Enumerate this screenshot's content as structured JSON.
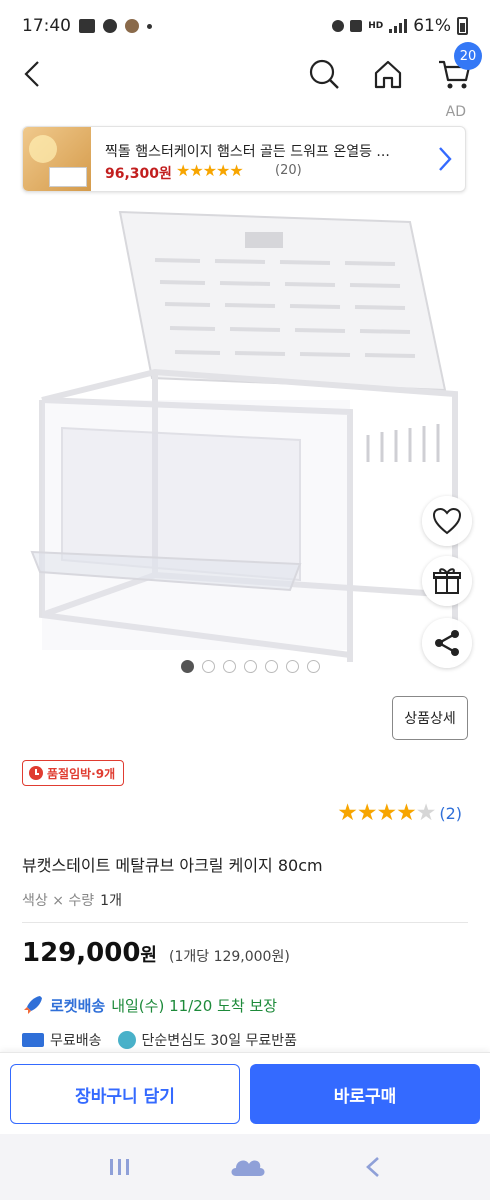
{
  "status_bar": {
    "time": "17:40",
    "battery": "61%",
    "network": "HD"
  },
  "nav": {
    "cart_count": "20"
  },
  "ad": {
    "tag": "AD",
    "title": "찍돌 햄스터케이지 햄스터 골든 드워프 온열등 ...",
    "price": "96,300원",
    "stars": "★★★★★",
    "review_count": "(20)"
  },
  "carousel": {
    "total": 7,
    "active": 1
  },
  "detail_button": "상품상세",
  "soldout_badge": "품절임박·9개",
  "rating": {
    "value": 4,
    "max": 5,
    "count": "(2)"
  },
  "product": {
    "name": "뷰캣스테이트 메탈큐브 아크릴 케이지 80cm",
    "option_label": "색상 × 수량",
    "option_qty": "1개",
    "price": "129,000",
    "price_currency": "원",
    "unit_price": "(1개당 129,000원)"
  },
  "delivery": {
    "rocket_label": "로켓배송",
    "rocket_date": "내일(수) 11/20 도착 보장",
    "free_shipping": "무료배송",
    "free_return": "단순변심도 30일 무료반품"
  },
  "actions": {
    "add_to_cart": "장바구니 담기",
    "buy_now": "바로구매"
  },
  "colors": {
    "accent": "#346aff",
    "price_red": "#c21f1f",
    "star": "#f7a500",
    "badge_red": "#e03c31"
  }
}
